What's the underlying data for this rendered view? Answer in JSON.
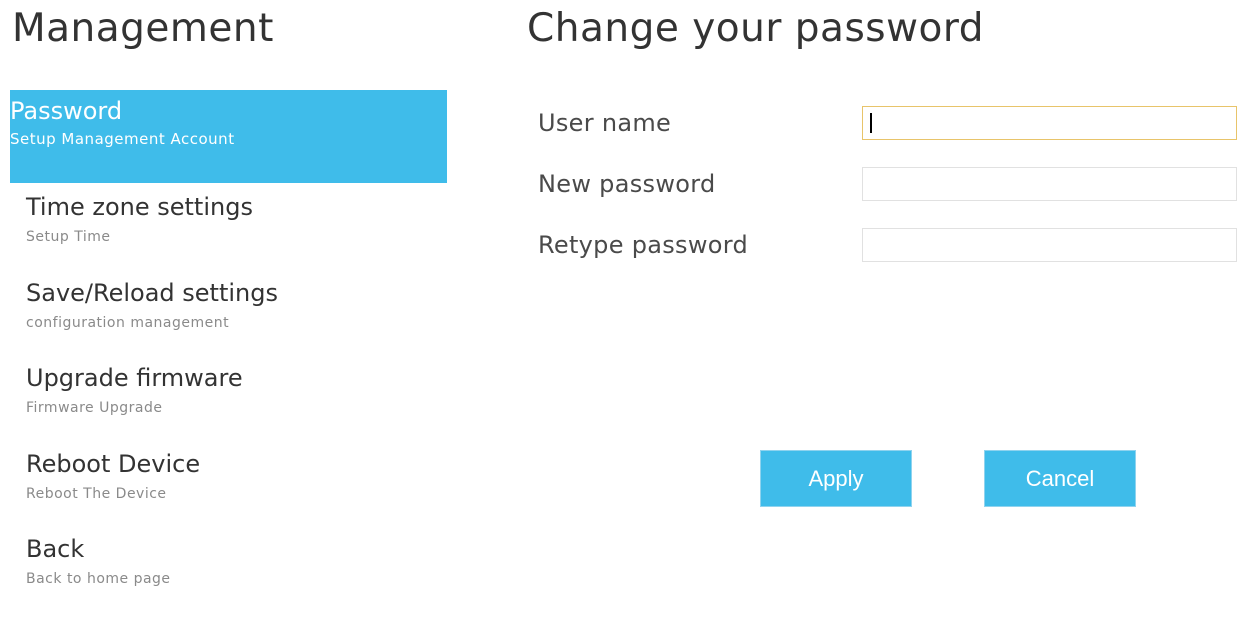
{
  "sidebar": {
    "title": "Management",
    "items": [
      {
        "label": "Password",
        "sub": "Setup Management Account"
      },
      {
        "label": "Time zone settings",
        "sub": "Setup Time"
      },
      {
        "label": "Save/Reload settings",
        "sub": "configuration management"
      },
      {
        "label": "Upgrade firmware",
        "sub": "Firmware Upgrade"
      },
      {
        "label": "Reboot Device",
        "sub": "Reboot The Device"
      },
      {
        "label": "Back",
        "sub": "Back to home page"
      }
    ],
    "active_index": 0,
    "accent_color": "#3fbcea"
  },
  "main": {
    "title": "Change your password",
    "fields": {
      "username": {
        "label": "User name",
        "value": ""
      },
      "new_password": {
        "label": "New password",
        "value": ""
      },
      "retype_password": {
        "label": "Retype password",
        "value": ""
      }
    },
    "buttons": {
      "apply": "Apply",
      "cancel": "Cancel"
    }
  }
}
